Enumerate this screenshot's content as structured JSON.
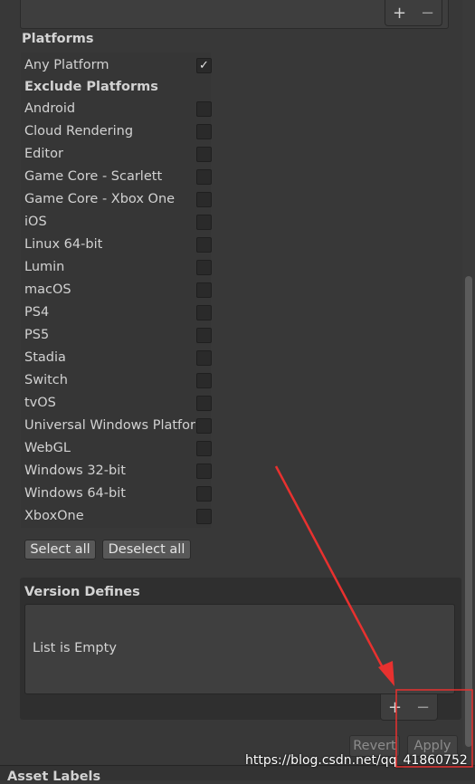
{
  "platforms": {
    "title": "Platforms",
    "any_platform": {
      "label": "Any Platform",
      "checked": true
    },
    "exclude_title": "Exclude Platforms",
    "items": [
      {
        "label": "Android",
        "checked": false
      },
      {
        "label": "Cloud Rendering",
        "checked": false
      },
      {
        "label": "Editor",
        "checked": false
      },
      {
        "label": "Game Core - Scarlett",
        "checked": false
      },
      {
        "label": "Game Core - Xbox One",
        "checked": false
      },
      {
        "label": "iOS",
        "checked": false
      },
      {
        "label": "Linux 64-bit",
        "checked": false
      },
      {
        "label": "Lumin",
        "checked": false
      },
      {
        "label": "macOS",
        "checked": false
      },
      {
        "label": "PS4",
        "checked": false
      },
      {
        "label": "PS5",
        "checked": false
      },
      {
        "label": "Stadia",
        "checked": false
      },
      {
        "label": "Switch",
        "checked": false
      },
      {
        "label": "tvOS",
        "checked": false
      },
      {
        "label": "Universal Windows Platform",
        "checked": false
      },
      {
        "label": "WebGL",
        "checked": false
      },
      {
        "label": "Windows 32-bit",
        "checked": false
      },
      {
        "label": "Windows 64-bit",
        "checked": false
      },
      {
        "label": "XboxOne",
        "checked": false
      }
    ],
    "select_all_label": "Select all",
    "deselect_all_label": "Deselect all"
  },
  "top_list": {
    "add_label": "+",
    "remove_label": "−"
  },
  "version_defines": {
    "title": "Version Defines",
    "empty_text": "List is Empty",
    "add_label": "+",
    "remove_label": "−"
  },
  "footer": {
    "revert_label": "Revert",
    "apply_label": "Apply",
    "asset_labels_title": "Asset Labels"
  },
  "watermark": "https://blog.csdn.net/qq_41860752",
  "icons": {
    "check": "check-icon",
    "add": "plus-icon",
    "remove": "minus-icon"
  },
  "colors": {
    "annotation": "#e8312f",
    "background": "#383838"
  }
}
